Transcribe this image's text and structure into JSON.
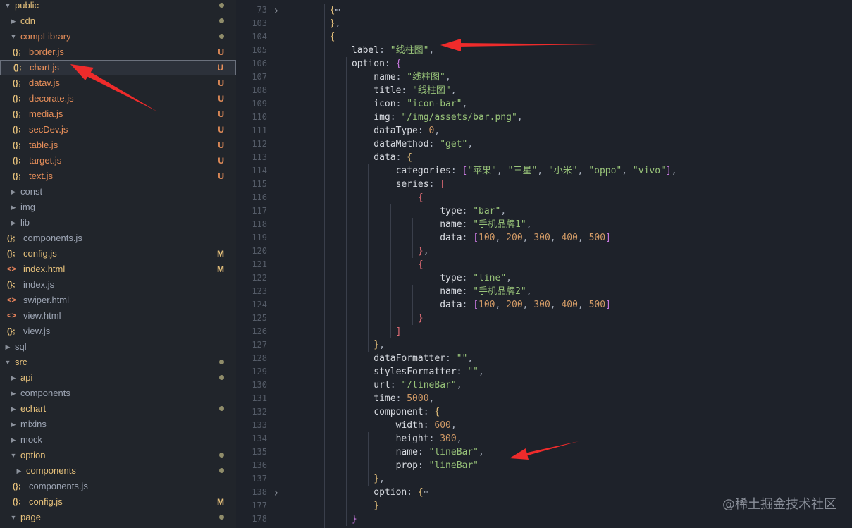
{
  "explorer": [
    {
      "depth": 0,
      "twisty": "open",
      "icon": "",
      "name": "public",
      "style": "mod",
      "status": "dot"
    },
    {
      "depth": 1,
      "twisty": "closed",
      "icon": "",
      "name": "cdn",
      "style": "mod",
      "status": "dot"
    },
    {
      "depth": 1,
      "twisty": "open",
      "icon": "",
      "name": "compLibrary",
      "style": "new",
      "status": "dot"
    },
    {
      "depth": 2,
      "twisty": "",
      "icon": "js",
      "name": "border.js",
      "style": "new",
      "status": "U"
    },
    {
      "depth": 2,
      "twisty": "",
      "icon": "js",
      "name": "chart.js",
      "style": "new",
      "status": "U",
      "selected": true
    },
    {
      "depth": 2,
      "twisty": "",
      "icon": "js",
      "name": "datav.js",
      "style": "new",
      "status": "U"
    },
    {
      "depth": 2,
      "twisty": "",
      "icon": "js",
      "name": "decorate.js",
      "style": "new",
      "status": "U"
    },
    {
      "depth": 2,
      "twisty": "",
      "icon": "js",
      "name": "media.js",
      "style": "new",
      "status": "U"
    },
    {
      "depth": 2,
      "twisty": "",
      "icon": "js",
      "name": "secDev.js",
      "style": "new",
      "status": "U"
    },
    {
      "depth": 2,
      "twisty": "",
      "icon": "js",
      "name": "table.js",
      "style": "new",
      "status": "U"
    },
    {
      "depth": 2,
      "twisty": "",
      "icon": "js",
      "name": "target.js",
      "style": "new",
      "status": "U"
    },
    {
      "depth": 2,
      "twisty": "",
      "icon": "js",
      "name": "text.js",
      "style": "new",
      "status": "U"
    },
    {
      "depth": 1,
      "twisty": "closed",
      "icon": "",
      "name": "const",
      "style": "plain",
      "status": ""
    },
    {
      "depth": 1,
      "twisty": "closed",
      "icon": "",
      "name": "img",
      "style": "plain",
      "status": ""
    },
    {
      "depth": 1,
      "twisty": "closed",
      "icon": "",
      "name": "lib",
      "style": "plain",
      "status": ""
    },
    {
      "depth": 1,
      "twisty": "",
      "icon": "js",
      "name": "components.js",
      "style": "plain",
      "status": ""
    },
    {
      "depth": 1,
      "twisty": "",
      "icon": "js",
      "name": "config.js",
      "style": "mod",
      "status": "M"
    },
    {
      "depth": 1,
      "twisty": "",
      "icon": "html",
      "name": "index.html",
      "style": "mod",
      "status": "M"
    },
    {
      "depth": 1,
      "twisty": "",
      "icon": "js",
      "name": "index.js",
      "style": "plain",
      "status": ""
    },
    {
      "depth": 1,
      "twisty": "",
      "icon": "html",
      "name": "swiper.html",
      "style": "plain",
      "status": ""
    },
    {
      "depth": 1,
      "twisty": "",
      "icon": "html",
      "name": "view.html",
      "style": "plain",
      "status": ""
    },
    {
      "depth": 1,
      "twisty": "",
      "icon": "js",
      "name": "view.js",
      "style": "plain",
      "status": ""
    },
    {
      "depth": 0,
      "twisty": "closed",
      "icon": "",
      "name": "sql",
      "style": "plain",
      "status": ""
    },
    {
      "depth": 0,
      "twisty": "open",
      "icon": "",
      "name": "src",
      "style": "mod",
      "status": "dot"
    },
    {
      "depth": 1,
      "twisty": "closed",
      "icon": "",
      "name": "api",
      "style": "mod",
      "status": "dot"
    },
    {
      "depth": 1,
      "twisty": "closed",
      "icon": "",
      "name": "components",
      "style": "plain",
      "status": ""
    },
    {
      "depth": 1,
      "twisty": "closed",
      "icon": "",
      "name": "echart",
      "style": "mod",
      "status": "dot"
    },
    {
      "depth": 1,
      "twisty": "closed",
      "icon": "",
      "name": "mixins",
      "style": "plain",
      "status": ""
    },
    {
      "depth": 1,
      "twisty": "closed",
      "icon": "",
      "name": "mock",
      "style": "plain",
      "status": ""
    },
    {
      "depth": 1,
      "twisty": "open",
      "icon": "",
      "name": "option",
      "style": "mod",
      "status": "dot"
    },
    {
      "depth": 2,
      "twisty": "closed",
      "icon": "",
      "name": "components",
      "style": "mod",
      "status": "dot"
    },
    {
      "depth": 2,
      "twisty": "",
      "icon": "js",
      "name": "components.js",
      "style": "plain",
      "status": ""
    },
    {
      "depth": 2,
      "twisty": "",
      "icon": "js",
      "name": "config.js",
      "style": "mod",
      "status": "M"
    },
    {
      "depth": 1,
      "twisty": "open",
      "icon": "",
      "name": "page",
      "style": "mod",
      "status": "dot"
    }
  ],
  "icons": {
    "js": "(};",
    "html": "<>"
  },
  "code": [
    {
      "num": "73",
      "fold": "closed",
      "indent": 2,
      "tokens": [
        [
          "b1",
          "{"
        ],
        [
          "p",
          "⋯"
        ]
      ]
    },
    {
      "num": "103",
      "indent": 2,
      "tokens": [
        [
          "b1",
          "}"
        ],
        [
          "p",
          ","
        ]
      ]
    },
    {
      "num": "104",
      "indent": 2,
      "tokens": [
        [
          "b1",
          "{"
        ]
      ]
    },
    {
      "num": "105",
      "indent": 3,
      "tokens": [
        [
          "k",
          "label"
        ],
        [
          "p",
          ": "
        ],
        [
          "s",
          "\"线柱图\""
        ],
        [
          "p",
          ","
        ]
      ]
    },
    {
      "num": "106",
      "indent": 3,
      "tokens": [
        [
          "k",
          "option"
        ],
        [
          "p",
          ": "
        ],
        [
          "b2",
          "{"
        ]
      ]
    },
    {
      "num": "107",
      "indent": 4,
      "tokens": [
        [
          "k",
          "name"
        ],
        [
          "p",
          ": "
        ],
        [
          "s",
          "\"线柱图\""
        ],
        [
          "p",
          ","
        ]
      ]
    },
    {
      "num": "108",
      "indent": 4,
      "tokens": [
        [
          "k",
          "title"
        ],
        [
          "p",
          ": "
        ],
        [
          "s",
          "\"线柱图\""
        ],
        [
          "p",
          ","
        ]
      ]
    },
    {
      "num": "109",
      "indent": 4,
      "tokens": [
        [
          "k",
          "icon"
        ],
        [
          "p",
          ": "
        ],
        [
          "s",
          "\"icon-bar\""
        ],
        [
          "p",
          ","
        ]
      ]
    },
    {
      "num": "110",
      "indent": 4,
      "tokens": [
        [
          "k",
          "img"
        ],
        [
          "p",
          ": "
        ],
        [
          "s",
          "\"/img/assets/bar.png\""
        ],
        [
          "p",
          ","
        ]
      ]
    },
    {
      "num": "111",
      "indent": 4,
      "tokens": [
        [
          "k",
          "dataType"
        ],
        [
          "p",
          ": "
        ],
        [
          "n",
          "0"
        ],
        [
          "p",
          ","
        ]
      ]
    },
    {
      "num": "112",
      "indent": 4,
      "tokens": [
        [
          "k",
          "dataMethod"
        ],
        [
          "p",
          ": "
        ],
        [
          "s",
          "\"get\""
        ],
        [
          "p",
          ","
        ]
      ]
    },
    {
      "num": "113",
      "indent": 4,
      "tokens": [
        [
          "k",
          "data"
        ],
        [
          "p",
          ": "
        ],
        [
          "b1",
          "{"
        ]
      ]
    },
    {
      "num": "114",
      "indent": 5,
      "tokens": [
        [
          "k",
          "categories"
        ],
        [
          "p",
          ": "
        ],
        [
          "b2",
          "["
        ],
        [
          "s",
          "\"苹果\""
        ],
        [
          "p",
          ", "
        ],
        [
          "s",
          "\"三星\""
        ],
        [
          "p",
          ", "
        ],
        [
          "s",
          "\"小米\""
        ],
        [
          "p",
          ", "
        ],
        [
          "s",
          "\"oppo\""
        ],
        [
          "p",
          ", "
        ],
        [
          "s",
          "\"vivo\""
        ],
        [
          "b2",
          "]"
        ],
        [
          "p",
          ","
        ]
      ]
    },
    {
      "num": "115",
      "indent": 5,
      "tokens": [
        [
          "k",
          "series"
        ],
        [
          "p",
          ": "
        ],
        [
          "b3",
          "["
        ]
      ]
    },
    {
      "num": "116",
      "indent": 6,
      "tokens": [
        [
          "b3",
          "{"
        ]
      ]
    },
    {
      "num": "117",
      "indent": 7,
      "tokens": [
        [
          "k",
          "type"
        ],
        [
          "p",
          ": "
        ],
        [
          "s",
          "\"bar\""
        ],
        [
          "p",
          ","
        ]
      ]
    },
    {
      "num": "118",
      "indent": 7,
      "tokens": [
        [
          "k",
          "name"
        ],
        [
          "p",
          ": "
        ],
        [
          "s",
          "\"手机品牌1\""
        ],
        [
          "p",
          ","
        ]
      ]
    },
    {
      "num": "119",
      "indent": 7,
      "tokens": [
        [
          "k",
          "data"
        ],
        [
          "p",
          ": "
        ],
        [
          "b2",
          "["
        ],
        [
          "n",
          "100"
        ],
        [
          "p",
          ", "
        ],
        [
          "n",
          "200"
        ],
        [
          "p",
          ", "
        ],
        [
          "n",
          "300"
        ],
        [
          "p",
          ", "
        ],
        [
          "n",
          "400"
        ],
        [
          "p",
          ", "
        ],
        [
          "n",
          "500"
        ],
        [
          "b2",
          "]"
        ]
      ]
    },
    {
      "num": "120",
      "indent": 6,
      "tokens": [
        [
          "b3",
          "}"
        ],
        [
          "p",
          ","
        ]
      ]
    },
    {
      "num": "121",
      "indent": 6,
      "tokens": [
        [
          "b3",
          "{"
        ]
      ]
    },
    {
      "num": "122",
      "indent": 7,
      "tokens": [
        [
          "k",
          "type"
        ],
        [
          "p",
          ": "
        ],
        [
          "s",
          "\"line\""
        ],
        [
          "p",
          ","
        ]
      ]
    },
    {
      "num": "123",
      "indent": 7,
      "tokens": [
        [
          "k",
          "name"
        ],
        [
          "p",
          ": "
        ],
        [
          "s",
          "\"手机品牌2\""
        ],
        [
          "p",
          ","
        ]
      ]
    },
    {
      "num": "124",
      "indent": 7,
      "tokens": [
        [
          "k",
          "data"
        ],
        [
          "p",
          ": "
        ],
        [
          "b2",
          "["
        ],
        [
          "n",
          "100"
        ],
        [
          "p",
          ", "
        ],
        [
          "n",
          "200"
        ],
        [
          "p",
          ", "
        ],
        [
          "n",
          "300"
        ],
        [
          "p",
          ", "
        ],
        [
          "n",
          "400"
        ],
        [
          "p",
          ", "
        ],
        [
          "n",
          "500"
        ],
        [
          "b2",
          "]"
        ]
      ]
    },
    {
      "num": "125",
      "indent": 6,
      "tokens": [
        [
          "b3",
          "}"
        ]
      ]
    },
    {
      "num": "126",
      "indent": 5,
      "tokens": [
        [
          "b3",
          "]"
        ]
      ]
    },
    {
      "num": "127",
      "indent": 4,
      "tokens": [
        [
          "b1",
          "}"
        ],
        [
          "p",
          ","
        ]
      ]
    },
    {
      "num": "128",
      "indent": 4,
      "tokens": [
        [
          "k",
          "dataFormatter"
        ],
        [
          "p",
          ": "
        ],
        [
          "s",
          "\"\""
        ],
        [
          "p",
          ","
        ]
      ]
    },
    {
      "num": "129",
      "indent": 4,
      "tokens": [
        [
          "k",
          "stylesFormatter"
        ],
        [
          "p",
          ": "
        ],
        [
          "s",
          "\"\""
        ],
        [
          "p",
          ","
        ]
      ]
    },
    {
      "num": "130",
      "indent": 4,
      "tokens": [
        [
          "k",
          "url"
        ],
        [
          "p",
          ": "
        ],
        [
          "s",
          "\"/lineBar\""
        ],
        [
          "p",
          ","
        ]
      ]
    },
    {
      "num": "131",
      "indent": 4,
      "tokens": [
        [
          "k",
          "time"
        ],
        [
          "p",
          ": "
        ],
        [
          "n",
          "5000"
        ],
        [
          "p",
          ","
        ]
      ]
    },
    {
      "num": "132",
      "indent": 4,
      "tokens": [
        [
          "k",
          "component"
        ],
        [
          "p",
          ": "
        ],
        [
          "b1",
          "{"
        ]
      ]
    },
    {
      "num": "133",
      "indent": 5,
      "tokens": [
        [
          "k",
          "width"
        ],
        [
          "p",
          ": "
        ],
        [
          "n",
          "600"
        ],
        [
          "p",
          ","
        ]
      ]
    },
    {
      "num": "134",
      "indent": 5,
      "tokens": [
        [
          "k",
          "height"
        ],
        [
          "p",
          ": "
        ],
        [
          "n",
          "300"
        ],
        [
          "p",
          ","
        ]
      ]
    },
    {
      "num": "135",
      "indent": 5,
      "tokens": [
        [
          "k",
          "name"
        ],
        [
          "p",
          ": "
        ],
        [
          "s",
          "\"lineBar\""
        ],
        [
          "p",
          ","
        ]
      ]
    },
    {
      "num": "136",
      "indent": 5,
      "tokens": [
        [
          "k",
          "prop"
        ],
        [
          "p",
          ": "
        ],
        [
          "s",
          "\"lineBar\""
        ]
      ]
    },
    {
      "num": "137",
      "indent": 4,
      "tokens": [
        [
          "b1",
          "}"
        ],
        [
          "p",
          ","
        ]
      ]
    },
    {
      "num": "138",
      "fold": "closed",
      "indent": 4,
      "tokens": [
        [
          "k",
          "option"
        ],
        [
          "p",
          ": "
        ],
        [
          "b1",
          "{"
        ],
        [
          "p",
          "⋯"
        ]
      ]
    },
    {
      "num": "177",
      "indent": 4,
      "tokens": [
        [
          "b1",
          "}"
        ]
      ]
    },
    {
      "num": "178",
      "indent": 3,
      "tokens": [
        [
          "b2",
          "}"
        ]
      ]
    }
  ],
  "watermark": "@稀土掘金技术社区",
  "colors": {
    "arrow": "#ef2b2b",
    "background": "#1e222a",
    "sidebar": "#21252b"
  }
}
